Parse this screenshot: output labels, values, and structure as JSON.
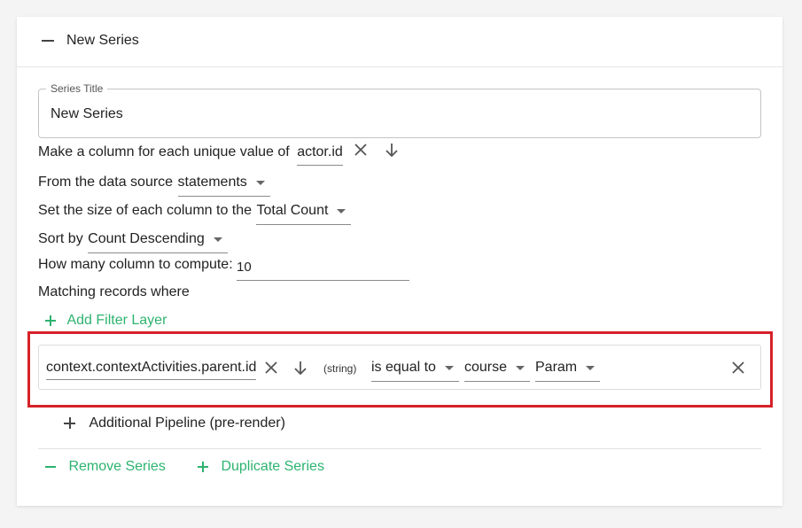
{
  "series": {
    "header_title": "New Series",
    "title_legend": "Series Title",
    "title_value": "New Series"
  },
  "rows": {
    "unique_prefix": "Make a column for each unique value of",
    "unique_field": "actor.id",
    "source_prefix": "From the data source",
    "source_value": "statements",
    "size_prefix": "Set the size of each column to the",
    "size_value": "Total Count",
    "sort_prefix": "Sort by",
    "sort_value": "Count Descending",
    "count_prefix": "How many column to compute:",
    "count_value": "10",
    "matching_label": "Matching records where"
  },
  "actions": {
    "add_filter_layer": "Add Filter Layer",
    "additional_pipeline": "Additional Pipeline (pre-render)",
    "remove_series": "Remove Series",
    "duplicate_series": "Duplicate Series"
  },
  "filter": {
    "field": "context.contextActivities.parent.id",
    "type_tag": "(string)",
    "operator": "is equal to",
    "value": "course",
    "param": "Param"
  },
  "colors": {
    "accent_green": "#2db36f",
    "highlight_red": "#d62128"
  },
  "icons": {
    "close": "close-icon",
    "arrow_down": "arrow-down-icon",
    "plus": "plus-icon",
    "minus": "minus-icon"
  }
}
